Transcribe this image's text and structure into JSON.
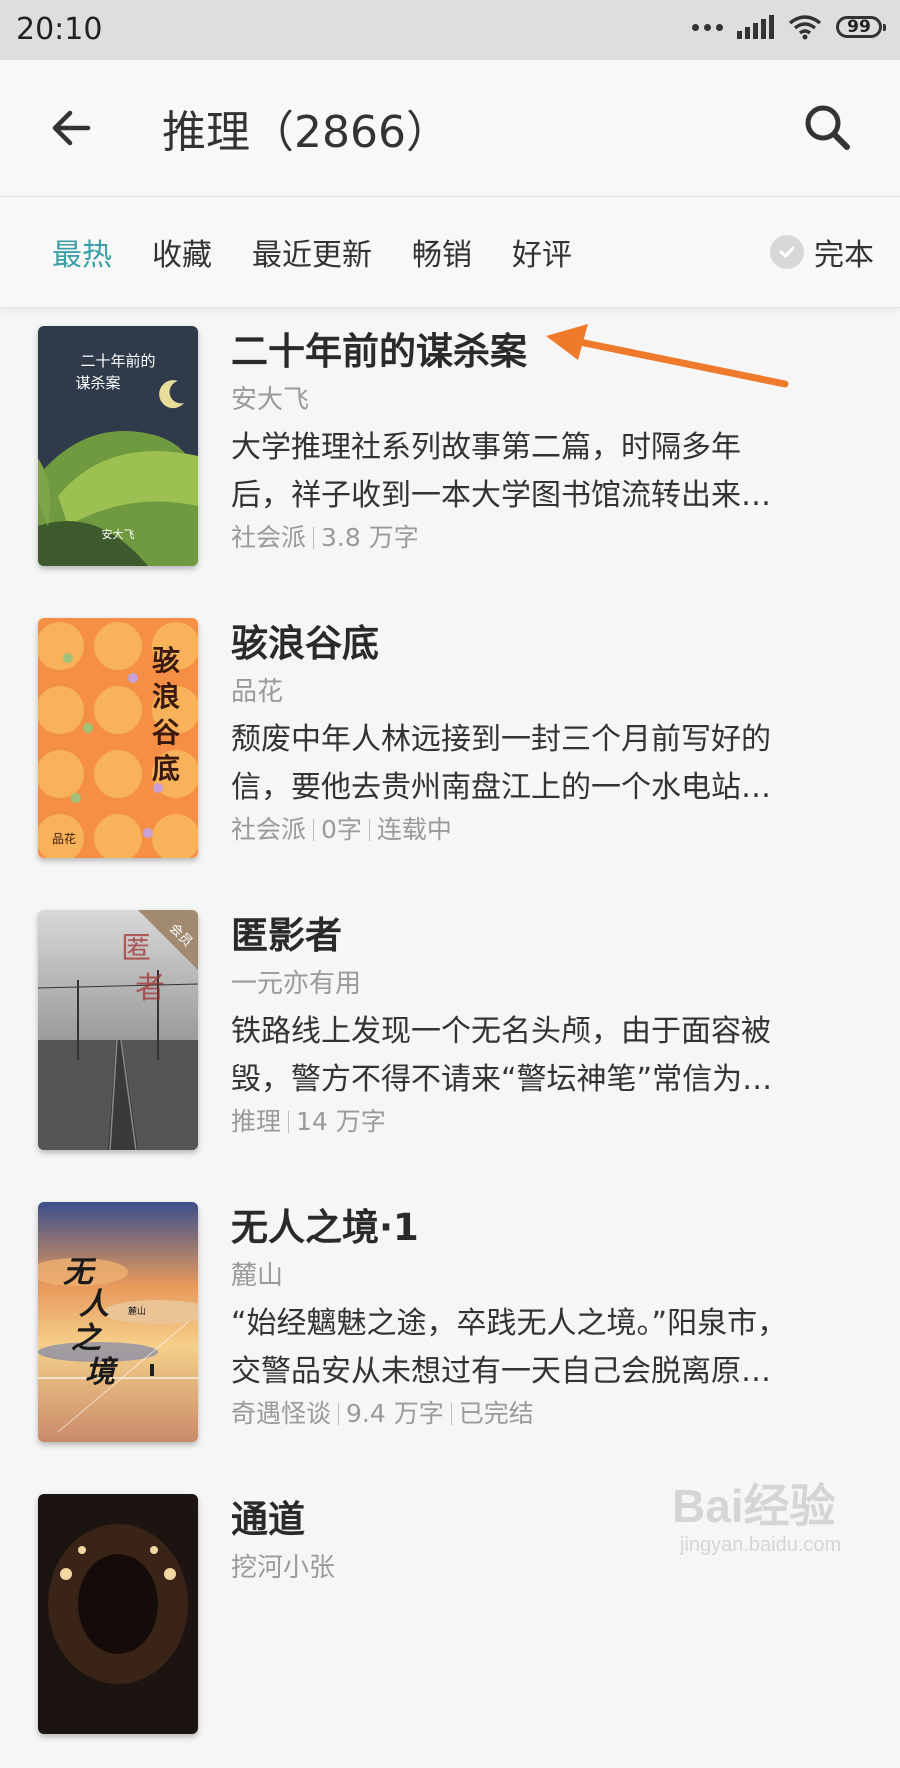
{
  "status_bar": {
    "time": "20:10",
    "battery": "99",
    "icons": [
      "more-dots-icon",
      "signal-icon",
      "wifi-icon",
      "battery-icon"
    ]
  },
  "header": {
    "title": "推理（2866）",
    "back_icon": "back-arrow-icon",
    "search_icon": "search-icon"
  },
  "filters": {
    "tabs": [
      {
        "label": "最热",
        "active": true
      },
      {
        "label": "收藏",
        "active": false
      },
      {
        "label": "最近更新",
        "active": false
      },
      {
        "label": "畅销",
        "active": false
      },
      {
        "label": "好评",
        "active": false
      }
    ],
    "complete_label": "完本",
    "accent_color": "#3a9fa6"
  },
  "books": [
    {
      "title": "二十年前的谋杀案",
      "author": "安大飞",
      "desc_line1": "大学推理社系列故事第二篇，时隔多年",
      "desc_line2": "后，祥子收到一本大学图书馆流转出来…",
      "meta": [
        "社会派",
        "3.8 万字"
      ],
      "cover_text": [
        "二十年前的",
        "谋杀案"
      ],
      "cover_author": "安大飞"
    },
    {
      "title": "骇浪谷底",
      "author": "品花",
      "desc_line1": "颓废中年人林远接到一封三个月前写好的",
      "desc_line2": "信，要他去贵州南盘江上的一个水电站…",
      "meta": [
        "社会派",
        "0字",
        "连载中"
      ],
      "cover_text": [
        "骇",
        "浪",
        "谷",
        "底"
      ],
      "cover_author": "品花"
    },
    {
      "title": "匿影者",
      "author": "一元亦有用",
      "desc_line1": "铁路线上发现一个无名头颅，由于面容被",
      "desc_line2": "毁，警方不得不请来“警坛神笔”常信为…",
      "meta": [
        "推理",
        "14 万字"
      ],
      "cover_text": [
        "匿",
        "者"
      ],
      "cover_badge": "会员"
    },
    {
      "title": "无人之境·1",
      "author": "麓山",
      "desc_line1": "“始经魑魅之途，卒践无人之境。”阳泉市，",
      "desc_line2": "交警品安从未想过有一天自己会脱离原…",
      "meta": [
        "奇遇怪谈",
        "9.4 万字",
        "已完结"
      ],
      "cover_text": [
        "无",
        "人",
        "之",
        "境"
      ],
      "cover_author": "麓山"
    },
    {
      "title": "通道",
      "author": "挖河小张"
    }
  ],
  "annotation": {
    "color": "#f07a2c"
  },
  "watermark": {
    "brand": "Bai经验",
    "sub": "jingyan.baidu.com"
  }
}
